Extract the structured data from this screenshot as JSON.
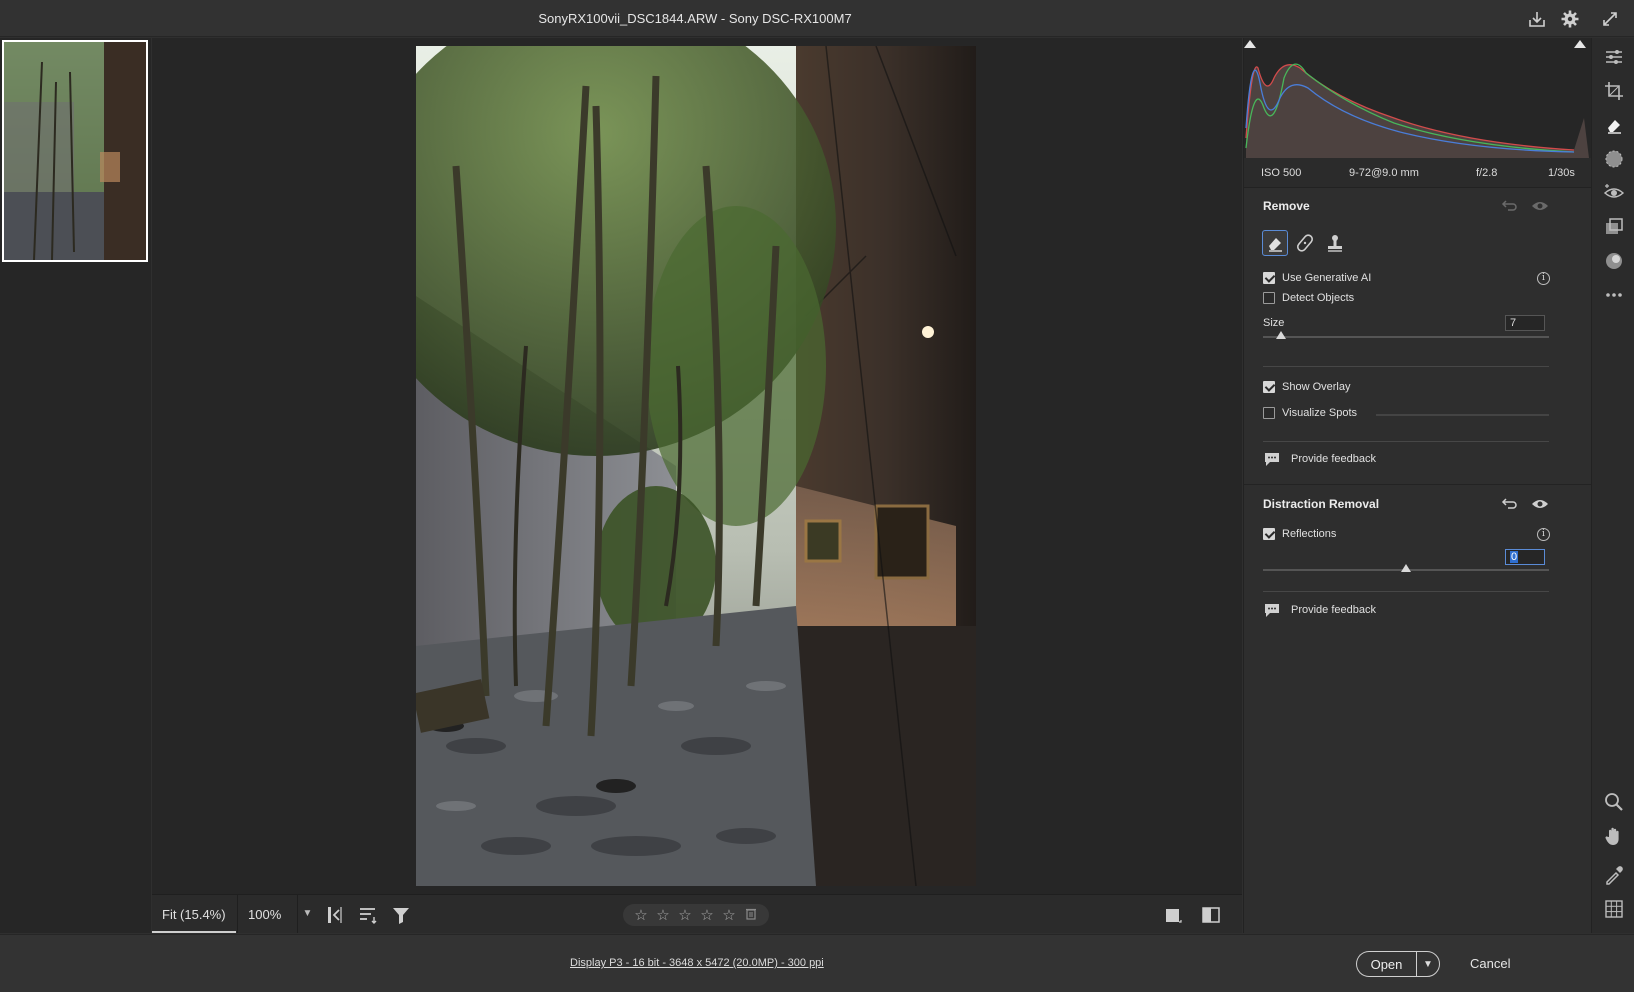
{
  "window": {
    "title": "SonyRX100vii_DSC1844.ARW  -  Sony DSC-RX100M7",
    "icons": [
      "save-icon",
      "settings-gear-icon",
      "fullscreen-icon"
    ]
  },
  "exif": {
    "iso": "ISO 500",
    "lens": "9-72@9.0 mm",
    "aperture": "f/2.8",
    "shutter": "1/30s"
  },
  "remove_panel": {
    "title": "Remove",
    "tools": [
      "eraser-tool",
      "healing-brush-tool",
      "clone-stamp-tool"
    ],
    "use_generative_ai": {
      "label": "Use Generative AI",
      "checked": true
    },
    "detect_objects": {
      "label": "Detect Objects",
      "checked": false
    },
    "size": {
      "label": "Size",
      "value": "7",
      "slider_fraction": 0.06
    },
    "show_overlay": {
      "label": "Show Overlay",
      "checked": true
    },
    "visualize_spots": {
      "label": "Visualize Spots",
      "checked": false
    },
    "feedback": "Provide feedback"
  },
  "distraction_panel": {
    "title": "Distraction Removal",
    "reflections": {
      "label": "Reflections",
      "checked": true,
      "value": "0",
      "slider_fraction": 0.5
    },
    "feedback": "Provide feedback"
  },
  "canvas_toolbar": {
    "fit": "Fit (15.4%)",
    "zoom": "100%",
    "stars": [
      "☆",
      "☆",
      "☆",
      "☆",
      "☆"
    ]
  },
  "footer": {
    "info": "Display P3 - 16 bit - 3648 x 5472 (20.0MP) - 300 ppi",
    "open": "Open",
    "cancel": "Cancel"
  },
  "colors": {
    "accent": "#5a8bd6",
    "panel_bg": "#2e2e2e",
    "canvas_bg": "#262626"
  }
}
